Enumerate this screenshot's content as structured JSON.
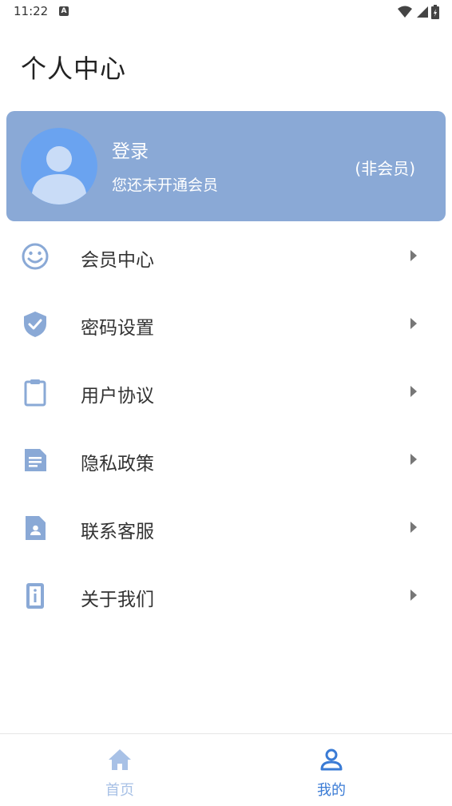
{
  "status_bar": {
    "time": "11:22",
    "notification_badge": "A",
    "icons": [
      "wifi-icon",
      "signal-icon",
      "battery-icon"
    ]
  },
  "header": {
    "title": "个人中心"
  },
  "profile": {
    "login_label": "登录",
    "member_note": "您还未开通会员",
    "member_status": "(非会员)",
    "card_color": "#8aa9d6"
  },
  "menu": {
    "items": [
      {
        "label": "会员中心",
        "icon": "smiley-icon"
      },
      {
        "label": "密码设置",
        "icon": "shield-check-icon"
      },
      {
        "label": "用户协议",
        "icon": "clipboard-icon"
      },
      {
        "label": "隐私政策",
        "icon": "document-icon"
      },
      {
        "label": "联系客服",
        "icon": "contact-card-icon"
      },
      {
        "label": "关于我们",
        "icon": "info-icon"
      }
    ],
    "icon_color": "#8aa9d6"
  },
  "bottom_nav": {
    "tabs": [
      {
        "label": "首页",
        "icon": "home-icon",
        "active": false
      },
      {
        "label": "我的",
        "icon": "user-icon",
        "active": true
      }
    ],
    "active_color": "#3a7bd5",
    "inactive_color": "#a8c1e6"
  }
}
